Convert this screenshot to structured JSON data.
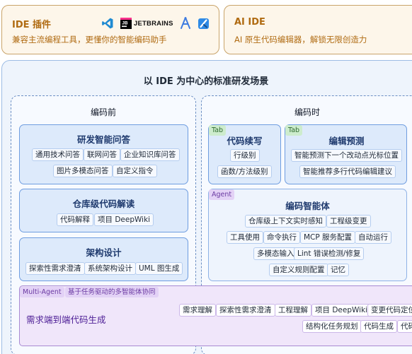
{
  "ide_plugins": {
    "title": "IDE 插件",
    "subtitle": "兼容主流编程工具，更懂你的智能编码助手",
    "icons": [
      "vscode-icon",
      "jetbrains-icon",
      "android-studio-icon",
      "xcode-icon"
    ],
    "jetbrains_label": "JETBRAINS"
  },
  "ai_ide": {
    "title": "AI IDE",
    "subtitle": "AI 原生代码编辑器，解锁无限创造力"
  },
  "main": {
    "title": "以 IDE 为中心的标准研发场景",
    "before": {
      "title": "编码前",
      "qa": {
        "title": "研发智能问答",
        "chips": [
          "通用技术问答",
          "联网问答",
          "企业知识库问答",
          "图片多模态问答",
          "自定义指令"
        ]
      },
      "repo": {
        "title": "仓库级代码解读",
        "chips": [
          "代码解释",
          "项目 DeepWiki"
        ]
      },
      "arch": {
        "title": "架构设计",
        "chips": [
          "探索性需求澄清",
          "系统架构设计",
          "UML 图生成"
        ]
      }
    },
    "during": {
      "title": "编码时",
      "completion": {
        "tag": "Tab",
        "title": "代码续写",
        "chips": [
          "行级别",
          "函数/方法级别"
        ]
      },
      "prediction": {
        "tag": "Tab",
        "title": "编辑预测",
        "chips": [
          "智能预测下一个改动点光标位置",
          "智能推荐多行代码编辑建议"
        ]
      },
      "agent": {
        "tag": "Agent",
        "title": "编码智能体",
        "chips": [
          "仓库级上下文实时感知",
          "工程级变更",
          "工具使用",
          "命令执行",
          "MCP 服务配置",
          "自动运行",
          "多模态输入",
          "Lint 错误检测/修复",
          "自定义规则配置",
          "记忆"
        ]
      }
    },
    "multi_agent": {
      "tag": "Multi-Agent",
      "tag2": "基于任务驱动的多智能体协同",
      "title": "需求端到端代码生成",
      "chips": [
        "需求理解",
        "探索性需求澄清",
        "工程理解",
        "项目 DeepWiki",
        "变更代码定位",
        "结构化任务规划",
        "代码生成",
        "代码"
      ]
    }
  }
}
